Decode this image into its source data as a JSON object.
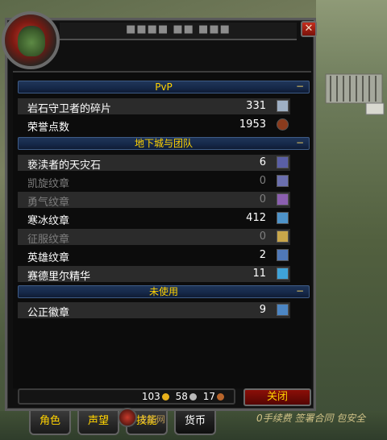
{
  "window": {
    "title": "■■■■ ■■ ■■■"
  },
  "sections": [
    {
      "label": "PvP",
      "collapse": "−",
      "rows": [
        {
          "name": "岩石守卫者的碎片",
          "count": "331",
          "icon": "stone-shard-icon",
          "dim": false,
          "icon_color": "#9fb0c4"
        },
        {
          "name": "荣誉点数",
          "count": "1953",
          "icon": "honor-icon",
          "dim": false,
          "icon_color": "#8a3b1d"
        }
      ]
    },
    {
      "label": "地下城与团队",
      "collapse": "−",
      "rows": [
        {
          "name": "亵渎者的天灾石",
          "count": "6",
          "icon": "scourgestone-icon",
          "dim": false,
          "icon_color": "#5a5fa6"
        },
        {
          "name": "凯旋纹章",
          "count": "0",
          "icon": "triumph-emblem-icon",
          "dim": true,
          "icon_color": "#6b6fae"
        },
        {
          "name": "勇气纹章",
          "count": "0",
          "icon": "valor-emblem-icon",
          "dim": true,
          "icon_color": "#8b5fb0"
        },
        {
          "name": "寒冰纹章",
          "count": "412",
          "icon": "frost-emblem-icon",
          "dim": false,
          "icon_color": "#4e93c9"
        },
        {
          "name": "征服纹章",
          "count": "0",
          "icon": "conquest-emblem-icon",
          "dim": true,
          "icon_color": "#c8a64a"
        },
        {
          "name": "英雄纹章",
          "count": "2",
          "icon": "heroism-emblem-icon",
          "dim": false,
          "icon_color": "#4f78b8"
        },
        {
          "name": "赛德里尔精华",
          "count": "11",
          "icon": "essence-icon",
          "dim": false,
          "icon_color": "#3fa3d8"
        }
      ]
    },
    {
      "label": "未使用",
      "collapse": "−",
      "rows": [
        {
          "name": "公正徽章",
          "count": "9",
          "icon": "justice-badge-icon",
          "dim": false,
          "icon_color": "#4c86c4"
        }
      ]
    }
  ],
  "money": {
    "gold": "103",
    "silver": "58",
    "copper": "17"
  },
  "close_button": "关闭",
  "tabs": [
    "角色",
    "声望",
    "技能",
    "货币"
  ],
  "active_tab": "货币",
  "watermark": {
    "center": "龙拓网",
    "right": "0手续费  签署合同  包安全"
  }
}
